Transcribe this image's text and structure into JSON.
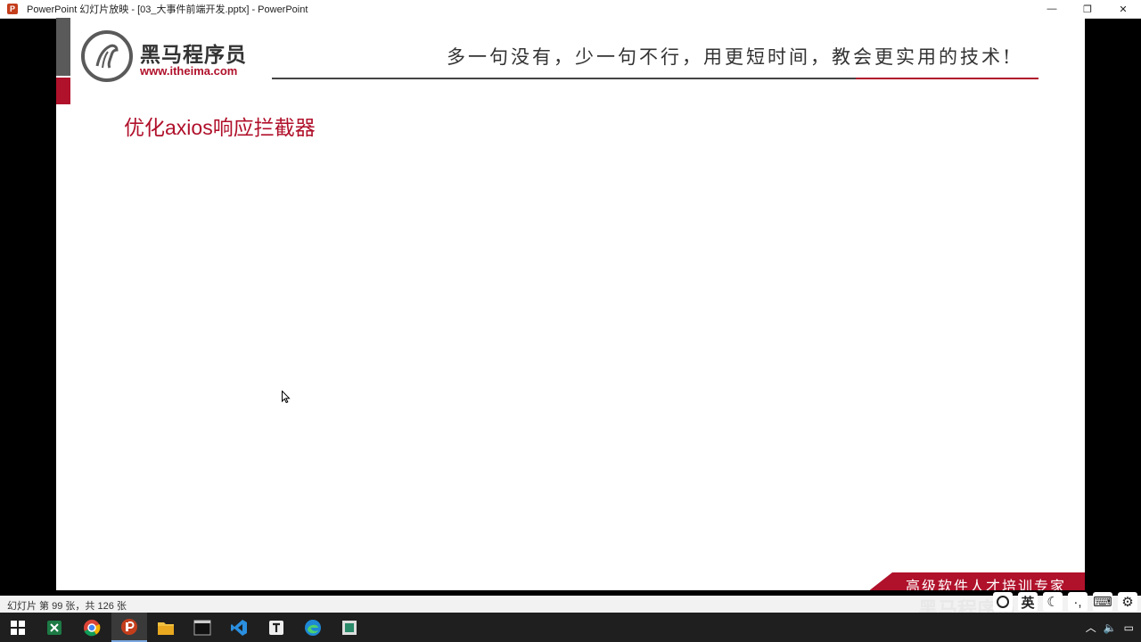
{
  "window": {
    "app_icon_letter": "P",
    "title": "PowerPoint 幻灯片放映 - [03_大事件前端开发.pptx] - PowerPoint",
    "controls": {
      "minimize": "—",
      "restore": "❐",
      "close": "✕"
    }
  },
  "slide": {
    "logo_cn": "黑马程序员",
    "logo_url": "www.itheima.com",
    "slogan": "多一句没有，少一句不行，用更短时间，教会更实用的技术!",
    "title": "优化axios响应拦截器",
    "footer_banner": "高级软件人才培训专家",
    "brand_color": "#b0112b"
  },
  "statusbar": {
    "slide_counter": "幻灯片 第 99 张，共 126 张",
    "watermark": "黑马程序员",
    "ime_lang": "英"
  },
  "taskbar": {
    "icons": [
      "windows-start-icon",
      "excel-icon",
      "chrome-icon",
      "powerpoint-icon",
      "file-explorer-icon",
      "terminal-icon",
      "vscode-icon",
      "typora-icon",
      "edge-icon",
      "app-icon"
    ]
  }
}
